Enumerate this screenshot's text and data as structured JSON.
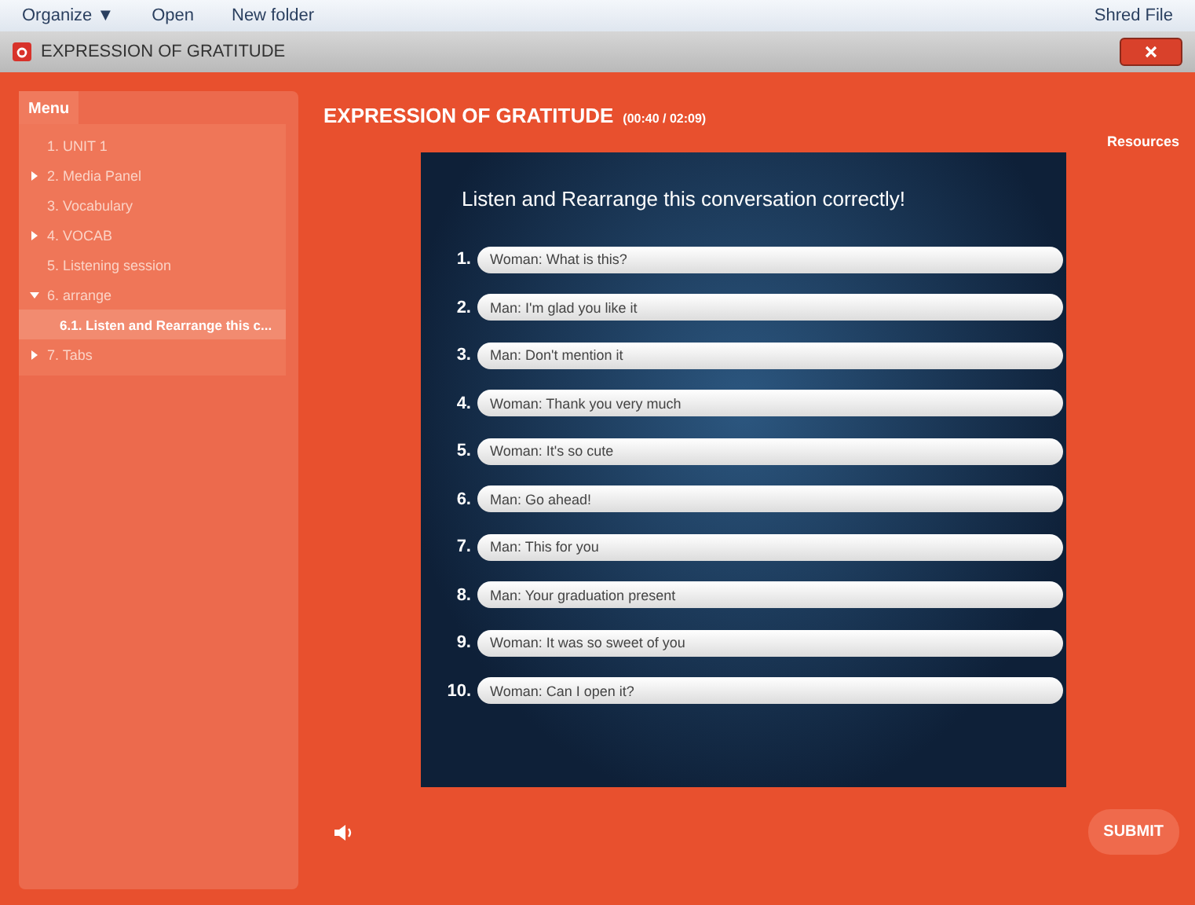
{
  "explorer_toolbar": {
    "items": [
      "Organize ▼",
      "Open",
      "New folder"
    ],
    "right_item": "Shred File"
  },
  "window": {
    "title": "EXPRESSION OF GRATITUDE"
  },
  "sidebar": {
    "title": "Menu",
    "items": [
      {
        "label": "1. UNIT 1",
        "selected": false
      },
      {
        "label": "2. Media Panel",
        "expanded": false,
        "selected": false
      },
      {
        "label": "3. Vocabulary",
        "selected": false
      },
      {
        "label": "4. VOCAB",
        "expanded": false,
        "selected": false
      },
      {
        "label": "5. Listening session",
        "selected": false
      },
      {
        "label": "6. arrange",
        "expanded": true,
        "selected": false,
        "children": [
          {
            "label": "6.1. Listen and Rearrange this c...",
            "selected": true
          }
        ]
      },
      {
        "label": "7. Tabs",
        "expanded": false,
        "selected": false
      }
    ]
  },
  "header": {
    "title": "EXPRESSION OF GRATITUDE",
    "time": "(00:40 / 02:09)",
    "resources": "Resources"
  },
  "slide": {
    "instruction": "Listen and Rearrange this conversation correctly!",
    "items": [
      {
        "number": "1.",
        "text": "Woman: What is this?"
      },
      {
        "number": "2.",
        "text": "Man: I'm glad you like it"
      },
      {
        "number": "3.",
        "text": "Man: Don't mention it"
      },
      {
        "number": "4.",
        "text": "Woman: Thank you very much"
      },
      {
        "number": "5.",
        "text": "Woman: It's so cute"
      },
      {
        "number": "6.",
        "text": "Man: Go ahead!"
      },
      {
        "number": "7.",
        "text": "Man: This for you"
      },
      {
        "number": "8.",
        "text": "Man: Your graduation present"
      },
      {
        "number": "9.",
        "text": "Woman: It was so sweet of you"
      },
      {
        "number": "10.",
        "text": "Woman: Can I open it?"
      }
    ]
  },
  "submit": "SUBMIT"
}
